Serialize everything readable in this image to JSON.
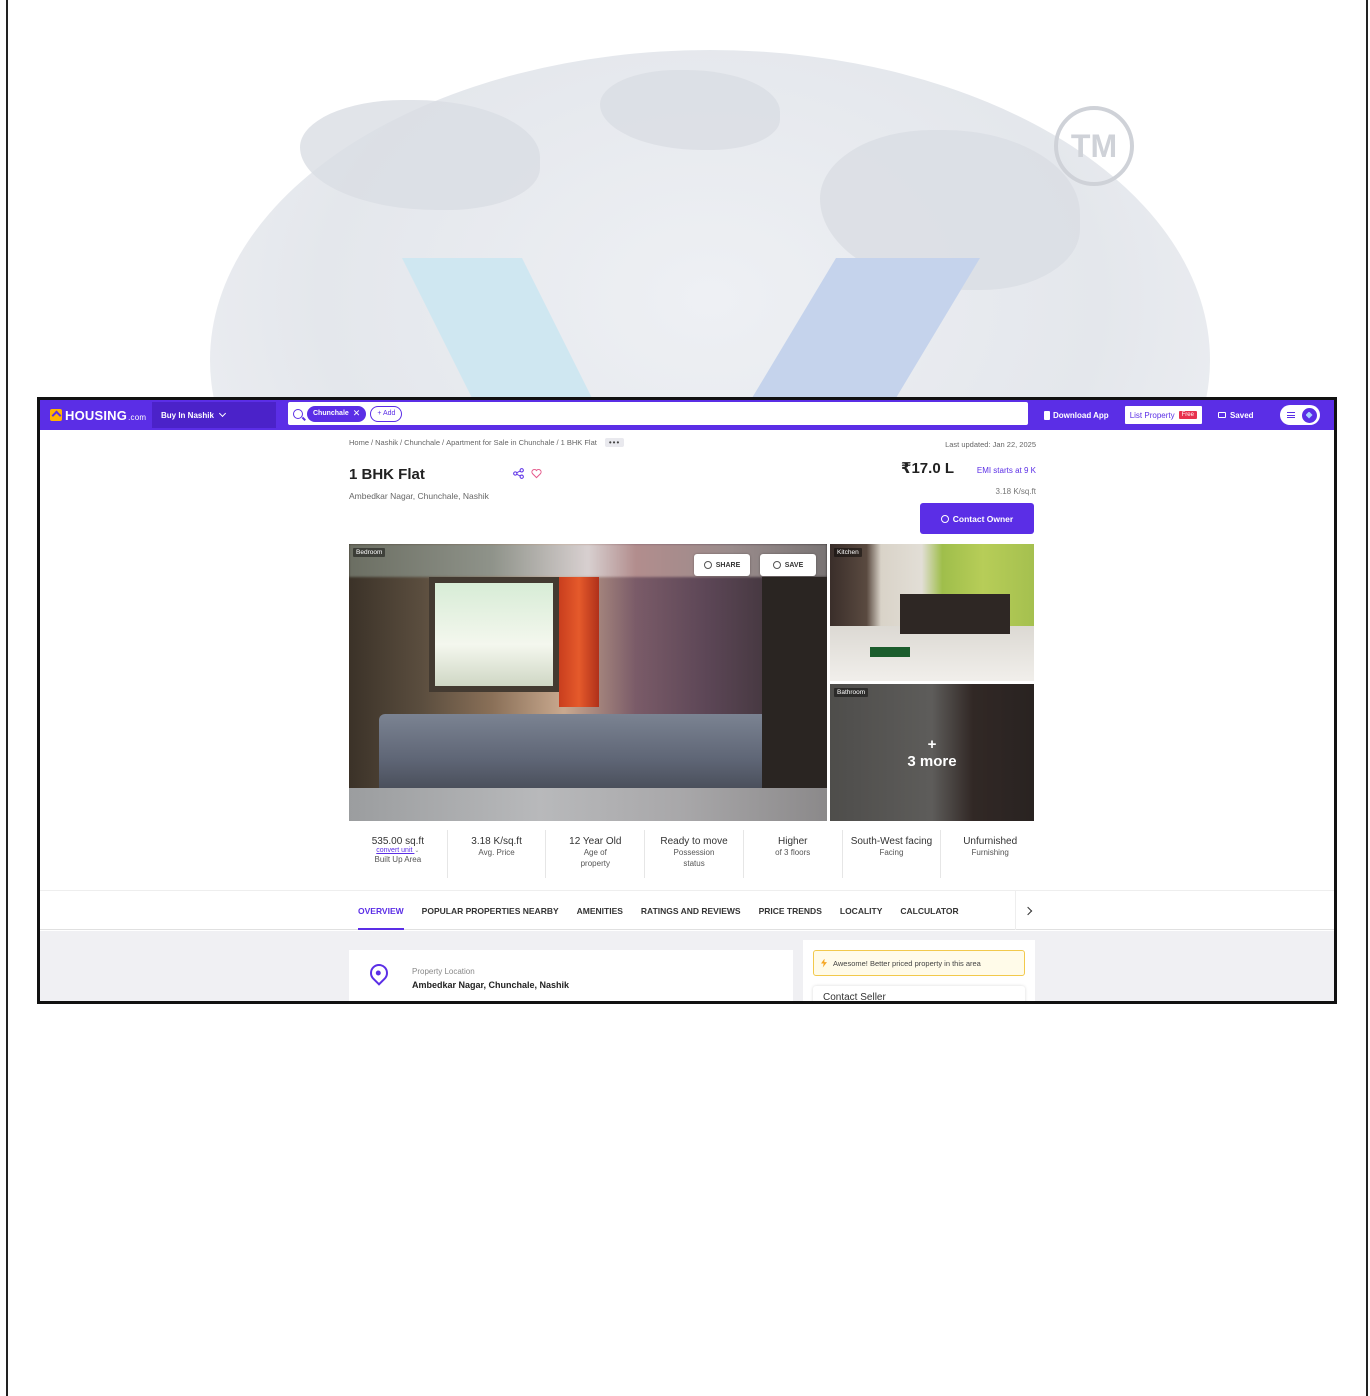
{
  "watermark": {
    "tm": "TM"
  },
  "header": {
    "logo": "HOUSING",
    "logo_suffix": ".com",
    "city_select": "Buy In Nashik",
    "search_chip": "Chunchale",
    "add_chip": "+ Add",
    "download_app": "Download App",
    "list_property": "List Property",
    "free_badge": "Free",
    "saved": "Saved"
  },
  "breadcrumb": {
    "items": [
      "Home",
      "Nashik",
      "Chunchale",
      "Apartment for Sale in Chunchale",
      "1 BHK Flat"
    ],
    "more": "•••"
  },
  "listing": {
    "last_updated": "Last updated: Jan 22, 2025",
    "title": "1 BHK Flat",
    "address": "Ambedkar Nagar, Chunchale, Nashik",
    "price": "₹17.0 L",
    "emi": "EMI starts at  9 K",
    "price_per_sqft": "3.18 K/sq.ft",
    "contact_button": "Contact Owner"
  },
  "gallery": {
    "main_label": "Bedroom",
    "share_label": "SHARE",
    "save_label": "SAVE",
    "side1_label": "Kitchen",
    "side2_label": "Bathroom",
    "more_plus": "+",
    "more_text": "3 more"
  },
  "stats": [
    {
      "value": "535.00 sq.ft",
      "link": "convert unit",
      "label": "Built Up Area",
      "label2": ""
    },
    {
      "value": "3.18 K/sq.ft",
      "link": "",
      "label": "Avg. Price",
      "label2": ""
    },
    {
      "value": "12 Year Old",
      "link": "",
      "label": "Age of",
      "label2": "property"
    },
    {
      "value": "Ready to move",
      "link": "",
      "label": "Possession",
      "label2": "status"
    },
    {
      "value": "Higher",
      "link": "",
      "label": "of 3 floors",
      "label2": ""
    },
    {
      "value": "South-West facing",
      "link": "",
      "label": "Facing",
      "label2": ""
    },
    {
      "value": "Unfurnished",
      "link": "",
      "label": "Furnishing",
      "label2": ""
    }
  ],
  "tabs": [
    "OVERVIEW",
    "POPULAR PROPERTIES NEARBY",
    "AMENITIES",
    "RATINGS AND REVIEWS",
    "PRICE TRENDS",
    "LOCALITY",
    "CALCULATOR"
  ],
  "location_card": {
    "label": "Property Location",
    "value": "Ambedkar Nagar, Chunchale, Nashik"
  },
  "side_card": {
    "notice": "Awesome! Better priced property in this area",
    "contact_title": "Contact Seller"
  },
  "colors": {
    "brand": "#5b2ee6",
    "accent": "#ffb400",
    "free_badge": "#e8324d"
  }
}
